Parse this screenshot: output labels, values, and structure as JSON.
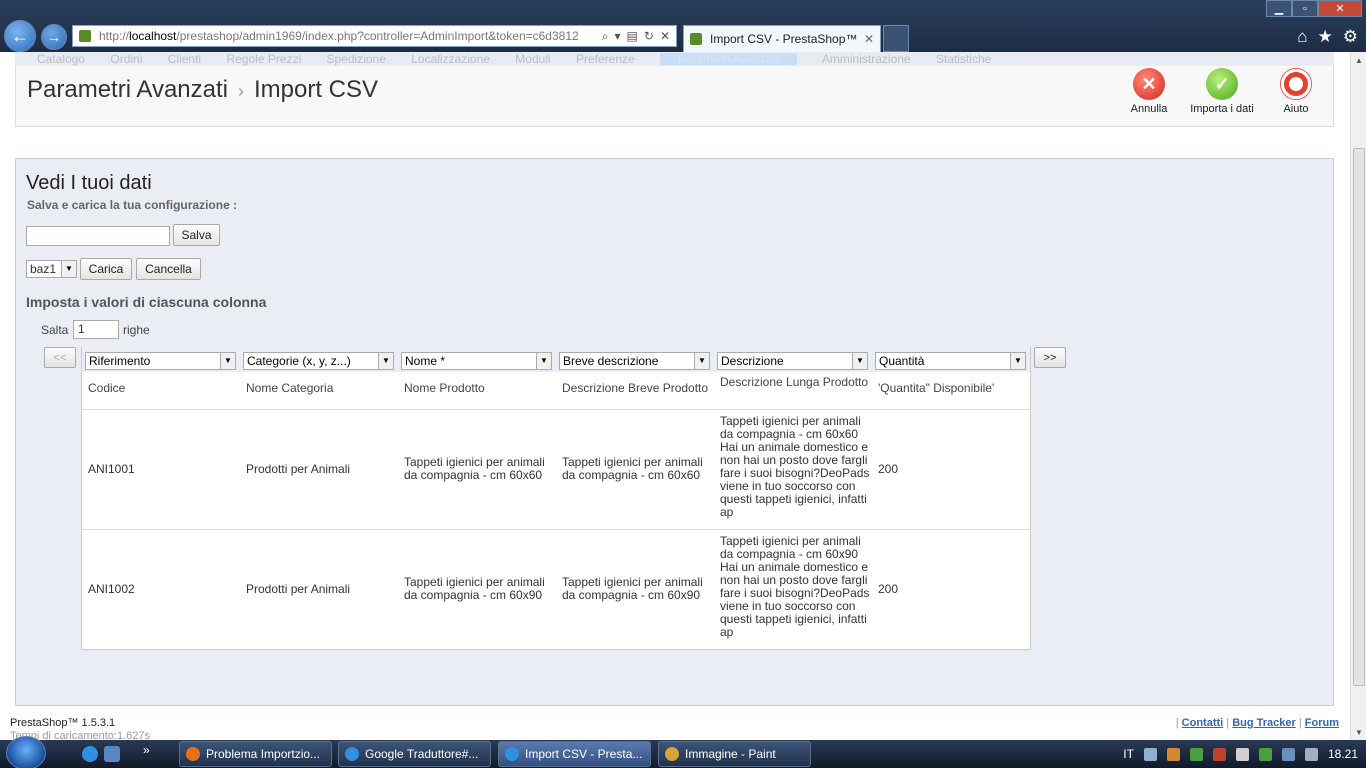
{
  "browser": {
    "url_prefix": "http://",
    "url_host": "localhost",
    "url_path": "/prestashop/admin1969/index.php?controller=AdminImport&token=c6d3812",
    "tab_title": "Import CSV - PrestaShop™",
    "tab_close": "✕",
    "win_min": "▁",
    "win_max": "▫",
    "win_close": "✕",
    "home_icon": "⌂",
    "star_icon": "★",
    "gear_icon": "⚙"
  },
  "topmenu": [
    "Catalogo",
    "Ordini",
    "Clienti",
    "Regole Prezzi",
    "Spedizione",
    "Localizzazione",
    "Moduli",
    "Preferenze",
    "Parametri Avanzati",
    "Amministrazione",
    "Statistiche"
  ],
  "breadcrumb": {
    "parent": "Parametri Avanzati",
    "separator": "›",
    "current": "Import CSV"
  },
  "toolbar": {
    "annulla": "Annulla",
    "importa": "Importa i dati",
    "aiuto": "Aiuto"
  },
  "panel": {
    "title": "Vedi I tuoi dati",
    "config_label": "Salva e carica la tua configurazione :",
    "config_input_value": "",
    "salva": "Salva",
    "config_select": "baz1",
    "carica": "Carica",
    "cancella": "Cancella",
    "columns_title": "Imposta i valori di ciascuna colonna",
    "skip_label": "Salta",
    "skip_value": "1",
    "rows_label": "righe",
    "prev": "<<",
    "next": ">>"
  },
  "grid": {
    "selects": [
      "Riferimento",
      "Categorie (x, y, z...)",
      "Nome *",
      "Breve descrizione",
      "Descrizione",
      "Quantità"
    ],
    "headers": [
      "Codice",
      "Nome Categoria",
      "Nome Prodotto",
      "Descrizione Breve Prodotto",
      "Descrizione Lunga Prodotto",
      "'Quantita\" Disponibile'"
    ],
    "rows": [
      [
        "ANI1001",
        "Prodotti per Animali",
        "Tappeti igienici per animali da compagnia - cm 60x60",
        "Tappeti igienici per animali da compagnia - cm 60x60",
        "Tappeti igienici per animali da compagnia - cm 60x60  Hai un animale domestico e non hai un posto dove fargli fare i suoi bisogni?DeoPads viene in tuo soccorso con questi tappeti igienici, infatti ap",
        "200"
      ],
      [
        "ANI1002",
        "Prodotti per Animali",
        "Tappeti igienici per animali da compagnia - cm 60x90",
        "Tappeti igienici per animali da compagnia - cm 60x90",
        "Tappeti igienici per animali da compagnia - cm 60x90  Hai un animale domestico e non hai un posto dove fargli fare i suoi bisogni?DeoPads viene in tuo soccorso con questi tappeti igienici, infatti ap",
        "200"
      ]
    ]
  },
  "footer": {
    "version": "PrestaShop™ 1.5.3.1",
    "load_time": "Tempi di caricamento:1.627s",
    "sep": "|",
    "contatti": "Contatti",
    "bug_tracker": "Bug Tracker",
    "forum": "Forum"
  },
  "taskbar": {
    "tasks": [
      "Problema Importzio...",
      "Google Traduttore#...",
      "Import CSV - Presta...",
      "Immagine - Paint"
    ],
    "lang": "IT",
    "clock": "18.21",
    "more": "»"
  },
  "colors": {
    "panel_bg": "#ebedf4",
    "link": "#3366aa",
    "taskbar": "#1c2a40"
  }
}
